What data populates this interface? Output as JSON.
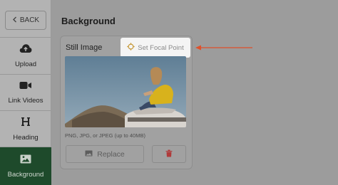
{
  "sidebar": {
    "back_label": "BACK",
    "items": [
      {
        "label": "Upload",
        "icon": "cloud-upload-icon"
      },
      {
        "label": "Link Videos",
        "icon": "video-camera-icon"
      },
      {
        "label": "Heading",
        "icon": "heading-icon"
      },
      {
        "label": "Background",
        "icon": "image-icon",
        "active": true
      }
    ]
  },
  "panel": {
    "title": "Background",
    "still_image_label": "Still Image",
    "focal_point_label": "Set Focal Point",
    "file_hint": "PNG, JPG, or JPEG (up to 40MB)",
    "replace_label": "Replace"
  },
  "colors": {
    "active_nav": "#1e4a2b",
    "delete_red": "#b03a3a",
    "arrow_red": "#e0502a"
  }
}
